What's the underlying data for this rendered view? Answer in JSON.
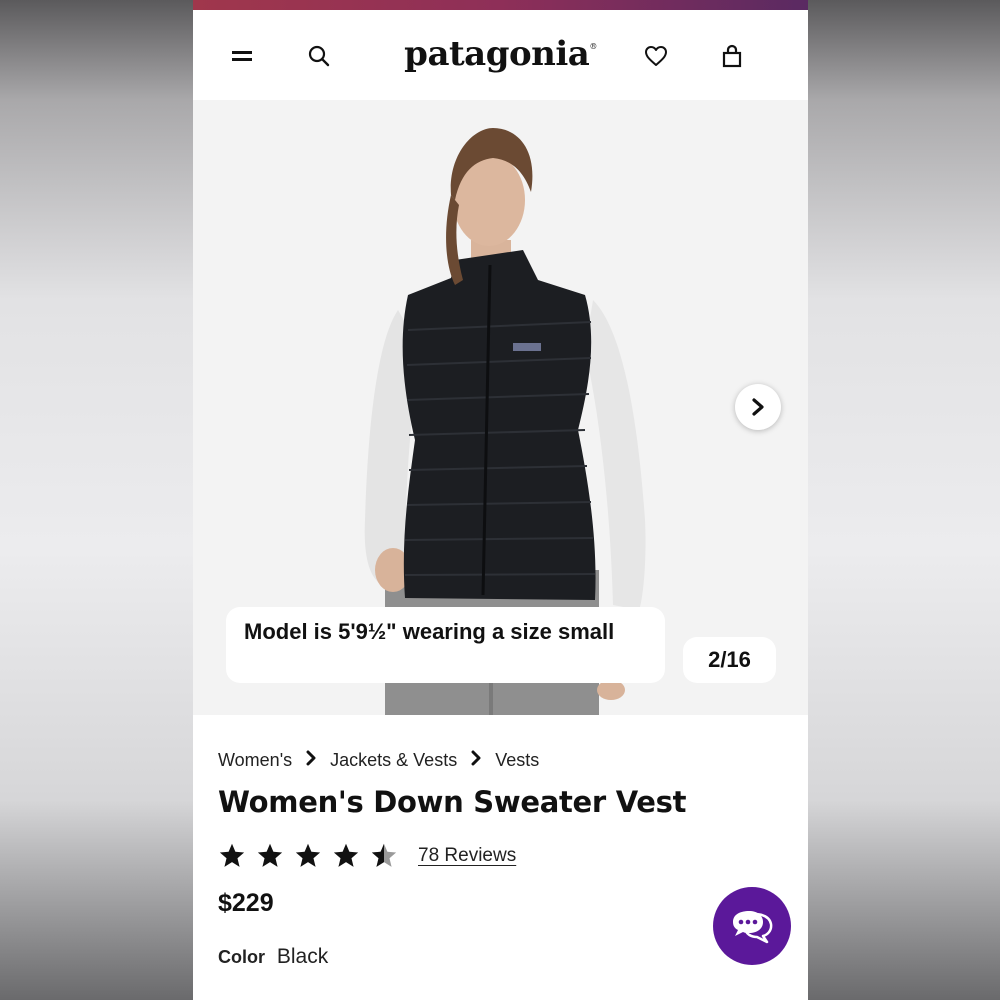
{
  "header": {
    "brand": "patagonia",
    "brand_mark": "®",
    "icons": [
      "menu-icon",
      "search-icon",
      "heart-icon",
      "bag-icon"
    ]
  },
  "gallery": {
    "caption": "Model is 5'9½\" wearing a size small",
    "counter": "2/16"
  },
  "breadcrumb": [
    "Women's",
    "Jackets & Vests",
    "Vests"
  ],
  "product": {
    "title": "Women's Down Sweater Vest",
    "rating": 4.5,
    "reviews_label": "78 Reviews",
    "price": "$229",
    "color_label": "Color",
    "color_value": "Black"
  },
  "colors": {
    "top_bar_start": "#a0374c",
    "top_bar_end": "#5a2a62",
    "chat_button": "#5b189a"
  }
}
